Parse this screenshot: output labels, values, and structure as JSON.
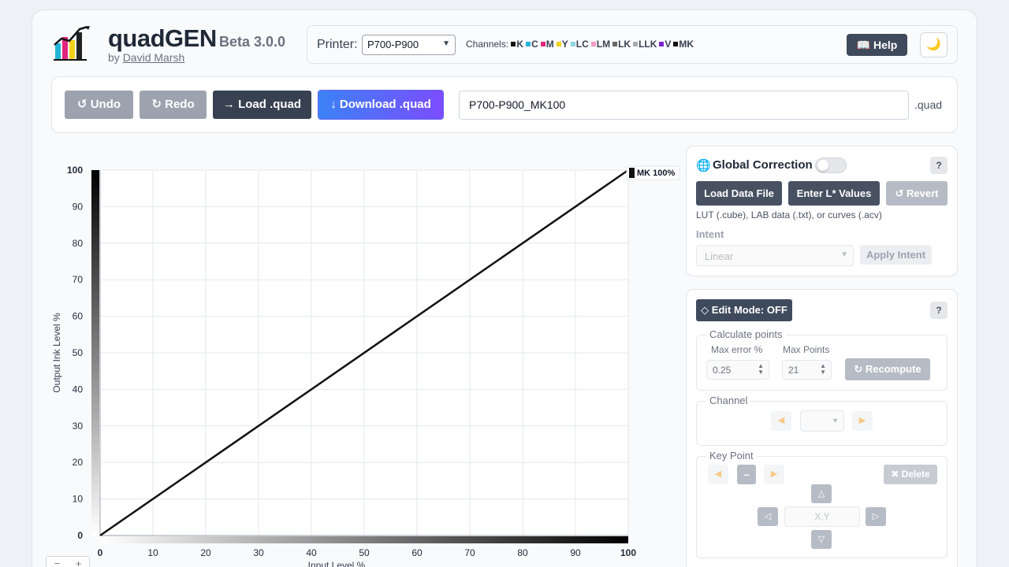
{
  "header": {
    "title": "quadGEN",
    "version": "Beta 3.0.0",
    "by_prefix": "by",
    "author": "David Marsh",
    "printer_label": "Printer:",
    "printer_selected": "P700-P900",
    "channels_label": "Channels:",
    "channels": [
      {
        "name": "K",
        "color": "#111111"
      },
      {
        "name": "C",
        "color": "#22b5d8"
      },
      {
        "name": "M",
        "color": "#e0267e"
      },
      {
        "name": "Y",
        "color": "#f2d21b"
      },
      {
        "name": "LC",
        "color": "#8fd6ea"
      },
      {
        "name": "LM",
        "color": "#f29bc6"
      },
      {
        "name": "LK",
        "color": "#666666"
      },
      {
        "name": "LLK",
        "color": "#aaaaaa"
      },
      {
        "name": "V",
        "color": "#7e22ce"
      },
      {
        "name": "MK",
        "color": "#111111"
      }
    ],
    "help_label": "📖 Help",
    "theme_icon": "🌙"
  },
  "toolbar": {
    "undo_label": "↺ Undo",
    "redo_label": "↻ Redo",
    "load_label": "→ Load .quad",
    "download_label": "↓ Download .quad",
    "filename": "P700-P900_MK100",
    "extension": ".quad"
  },
  "chart_data": {
    "type": "line",
    "xlabel": "Input Level %",
    "ylabel": "Output Ink Level %",
    "xlim": [
      0,
      100
    ],
    "ylim": [
      0,
      100
    ],
    "x_ticks": [
      0,
      10,
      20,
      30,
      40,
      50,
      60,
      70,
      80,
      90,
      100
    ],
    "y_ticks": [
      0,
      10,
      20,
      30,
      40,
      50,
      60,
      70,
      80,
      90,
      100
    ],
    "grid": true,
    "series": [
      {
        "name": "MK",
        "color": "#111111",
        "x": [
          0,
          100
        ],
        "y": [
          0,
          100
        ],
        "end_label": "MK 100%"
      }
    ],
    "zoom_out": "−",
    "zoom_in": "+"
  },
  "global_correction": {
    "icon": "globe-icon",
    "title": "Global Correction",
    "enabled": false,
    "help": "?",
    "load_data_label": "Load Data File",
    "enter_l_label": "Enter L* Values",
    "revert_label": "↺ Revert",
    "hint": "LUT (.cube), LAB data (.txt), or curves (.acv)",
    "intent_label": "Intent",
    "intent_value": "Linear",
    "apply_intent_label": "Apply Intent"
  },
  "edit_panel": {
    "edit_mode_label": "◇ Edit Mode: OFF",
    "help": "?",
    "calc_points_label": "Calculate points",
    "max_error_label": "Max error %",
    "max_error_value": "0.25",
    "max_points_label": "Max Points",
    "max_points_value": "21",
    "recompute_label": "↻ Recompute",
    "channel_label": "Channel",
    "key_point_label": "Key Point",
    "delete_label": "✖ Delete",
    "minus_label": "–",
    "xy_placeholder": "X,Y"
  }
}
